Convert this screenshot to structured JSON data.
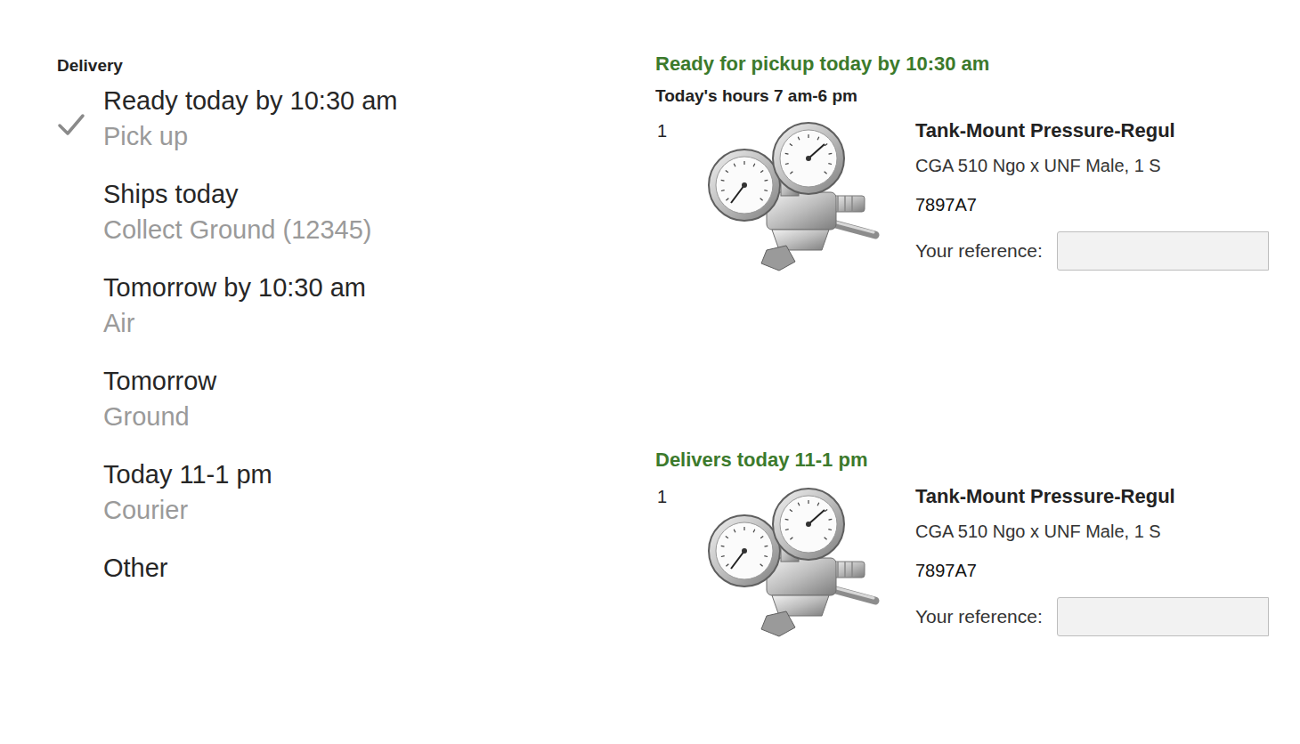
{
  "delivery": {
    "title": "Delivery",
    "options": [
      {
        "label": "Ready today by 10:30 am",
        "method": "Pick up",
        "selected": true
      },
      {
        "label": "Ships today",
        "method": "Collect Ground (12345)",
        "selected": false
      },
      {
        "label": "Tomorrow by 10:30 am",
        "method": "Air",
        "selected": false
      },
      {
        "label": "Tomorrow",
        "method": "Ground",
        "selected": false
      },
      {
        "label": "Today 11-1 pm",
        "method": "Courier",
        "selected": false
      },
      {
        "label": "Other",
        "selected": false
      }
    ]
  },
  "shipments": [
    {
      "heading": "Ready for pickup today by 10:30 am",
      "hours": "Today's hours 7 am-6 pm",
      "items": [
        {
          "quantity": "1",
          "name": "Tank-Mount Pressure-Regul",
          "description": "CGA 510 Ngo x UNF Male, 1 S",
          "part_number": "7897A7",
          "reference_label": "Your reference:"
        }
      ]
    },
    {
      "heading": "Delivers today 11-1 pm",
      "items": [
        {
          "quantity": "1",
          "name": "Tank-Mount Pressure-Regul",
          "description": "CGA 510 Ngo x UNF Male, 1 S",
          "part_number": "7897A7",
          "reference_label": "Your reference:"
        }
      ]
    }
  ]
}
